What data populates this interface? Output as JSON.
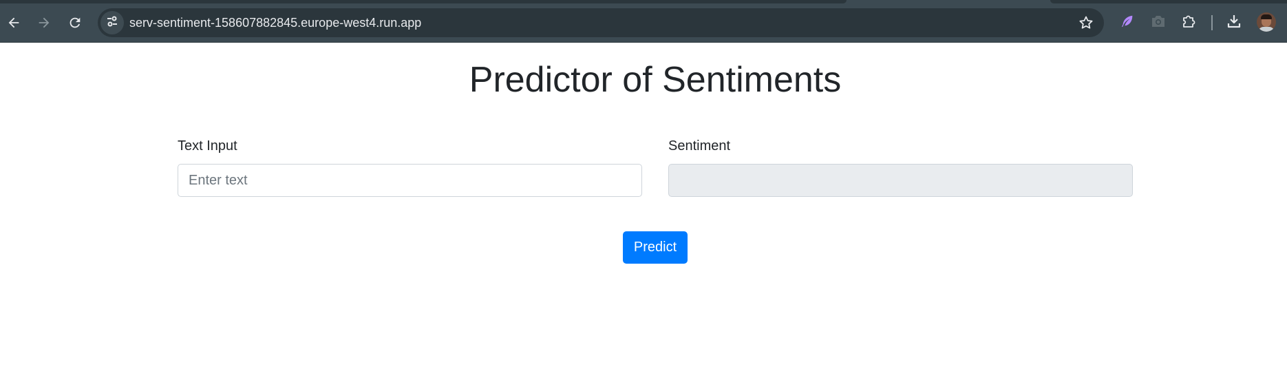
{
  "browser": {
    "url": "serv-sentiment-158607882845.europe-west4.run.app",
    "icons": {
      "back": "arrow-left-icon",
      "forward": "arrow-right-icon",
      "reload": "reload-icon",
      "site_info": "tune-icon",
      "bookmark": "star-icon",
      "extension_1": "feather-icon",
      "extension_2": "camera-icon",
      "extensions": "puzzle-icon",
      "downloads": "download-icon",
      "profile": "avatar"
    },
    "colors": {
      "toolbar": "#3c4a52",
      "omnibox": "#2b363c",
      "feather": "#b388ff"
    }
  },
  "page": {
    "title": "Predictor of Sentiments",
    "text_input": {
      "label": "Text Input",
      "placeholder": "Enter text",
      "value": ""
    },
    "sentiment": {
      "label": "Sentiment",
      "value": ""
    },
    "predict_button": "Predict",
    "colors": {
      "primary": "#007bff",
      "readonly_bg": "#e9ecef",
      "text": "#212529"
    }
  }
}
